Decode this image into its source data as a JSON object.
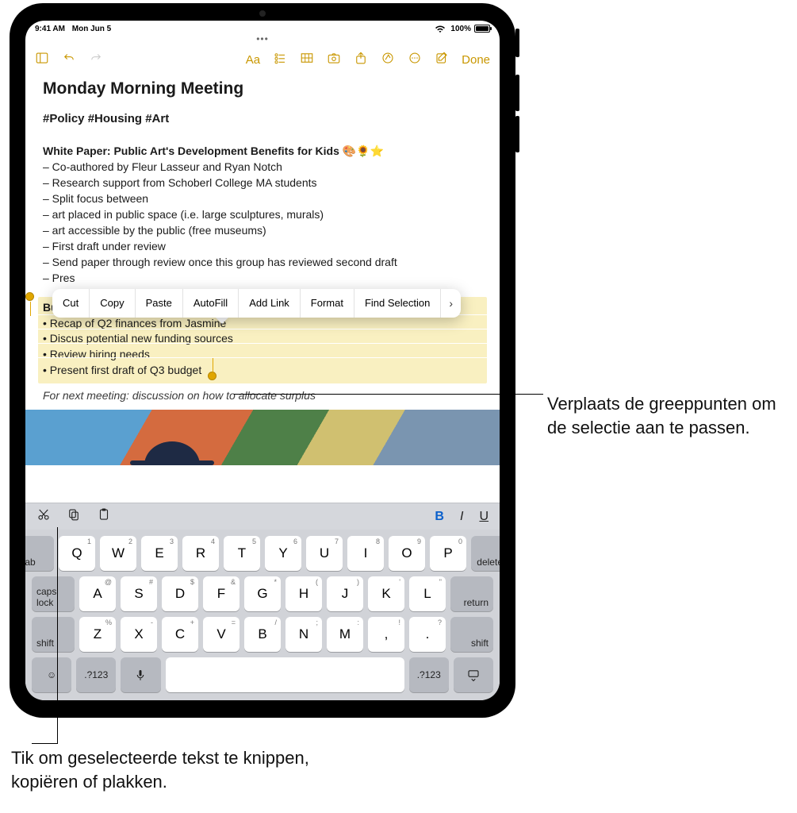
{
  "status": {
    "time": "9:41 AM",
    "date": "Mon Jun 5",
    "battery": "100%"
  },
  "toolbar": {
    "done": "Done"
  },
  "note": {
    "title": "Monday Morning Meeting",
    "tags": "#Policy #Housing #Art",
    "section_heading": "White Paper: Public Art's Development Benefits for Kids",
    "emoji": "🎨🌻⭐",
    "lines": [
      "– Co-authored by Fleur Lasseur and Ryan Notch",
      "– Research support from Schoberl College MA students",
      "– Split focus between",
      "– art placed in public space (i.e. large sculptures, murals)",
      "– art accessible by the public (free museums)",
      "– First draft under review",
      "– Send paper through review once this group has reviewed second draft",
      "– Pres"
    ],
    "selected": {
      "heading": "Budget check-in",
      "rows": [
        "• Recap of Q2 finances from Jasmine",
        "• Discus potential new funding sources",
        "• Review hiring needs",
        "• Present first draft of Q3 budget"
      ]
    },
    "next_meeting": "For next meeting: discussion on how to allocate surplus"
  },
  "edit_menu": [
    "Cut",
    "Copy",
    "Paste",
    "AutoFill",
    "Add Link",
    "Format",
    "Find Selection"
  ],
  "kb_format": {
    "B": "B",
    "I": "I",
    "U": "U"
  },
  "keyboard": {
    "row1_subs": [
      "1",
      "2",
      "3",
      "4",
      "5",
      "6",
      "7",
      "8",
      "9",
      "0"
    ],
    "row1": [
      "Q",
      "W",
      "E",
      "R",
      "T",
      "Y",
      "U",
      "I",
      "O",
      "P"
    ],
    "row2_subs": [
      "@",
      "#",
      "$",
      "&",
      "*",
      "(",
      ")",
      "'",
      "\""
    ],
    "row2": [
      "A",
      "S",
      "D",
      "F",
      "G",
      "H",
      "J",
      "K",
      "L"
    ],
    "row3_subs": [
      "%",
      "-",
      "+",
      "=",
      "/",
      ";",
      ":",
      "!",
      "?"
    ],
    "row3": [
      "Z",
      "X",
      "C",
      "V",
      "B",
      "N",
      "M",
      ",",
      "."
    ],
    "tab": "tab",
    "delete": "delete",
    "caps": "caps lock",
    "ret": "return",
    "shift": "shift",
    "numsym": ".?123"
  },
  "callouts": {
    "c1": "Verplaats de greeppunten om de selectie aan te passen.",
    "c2": "Tik om geselecteerde tekst te knippen, kopiëren of plakken."
  }
}
